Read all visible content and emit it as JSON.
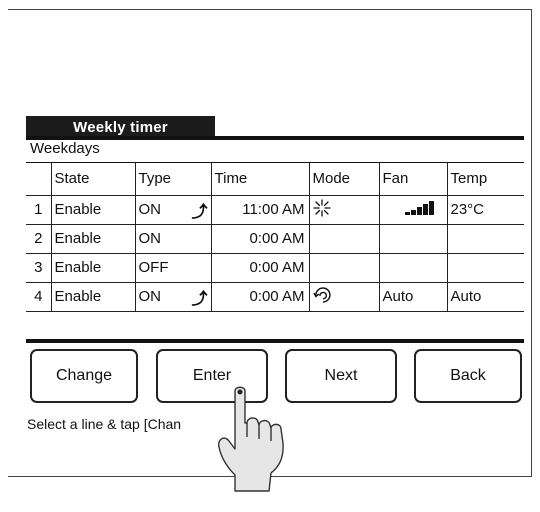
{
  "screen": {
    "title": "Weekly timer",
    "subtitle": "Weekdays"
  },
  "table": {
    "headers": [
      "",
      "State",
      "Type",
      "Time",
      "Mode",
      "Fan",
      "Temp"
    ],
    "rows": [
      {
        "num": "1",
        "state": "Enable",
        "type": "ON",
        "type_icon": "timer-arrow-icon",
        "time": "11:00  AM",
        "mode_icon": "snowflake-icon",
        "fan_icon": "fan-level-bars-icon",
        "fan": "",
        "temp": "23°C"
      },
      {
        "num": "2",
        "state": "Enable",
        "type": "ON",
        "type_icon": "",
        "time": "0:00  AM",
        "mode_icon": "",
        "fan_icon": "",
        "fan": "",
        "temp": ""
      },
      {
        "num": "3",
        "state": "Enable",
        "type": "OFF",
        "type_icon": "",
        "time": "0:00  AM",
        "mode_icon": "",
        "fan_icon": "",
        "fan": "",
        "temp": ""
      },
      {
        "num": "4",
        "state": "Enable",
        "type": "ON",
        "type_icon": "timer-arrow-icon",
        "time": "0:00  AM",
        "mode_icon": "auto-mode-icon",
        "fan_icon": "",
        "fan": "Auto",
        "temp": "Auto"
      }
    ]
  },
  "buttons": {
    "change": "Change",
    "enter": "Enter",
    "next": "Next",
    "back": "Back"
  },
  "hint": "Select a line & tap [Chan",
  "fan_level": 4,
  "colors": {
    "title_bg": "#1c1c1c",
    "line": "#111111",
    "background": "#ffffff"
  }
}
